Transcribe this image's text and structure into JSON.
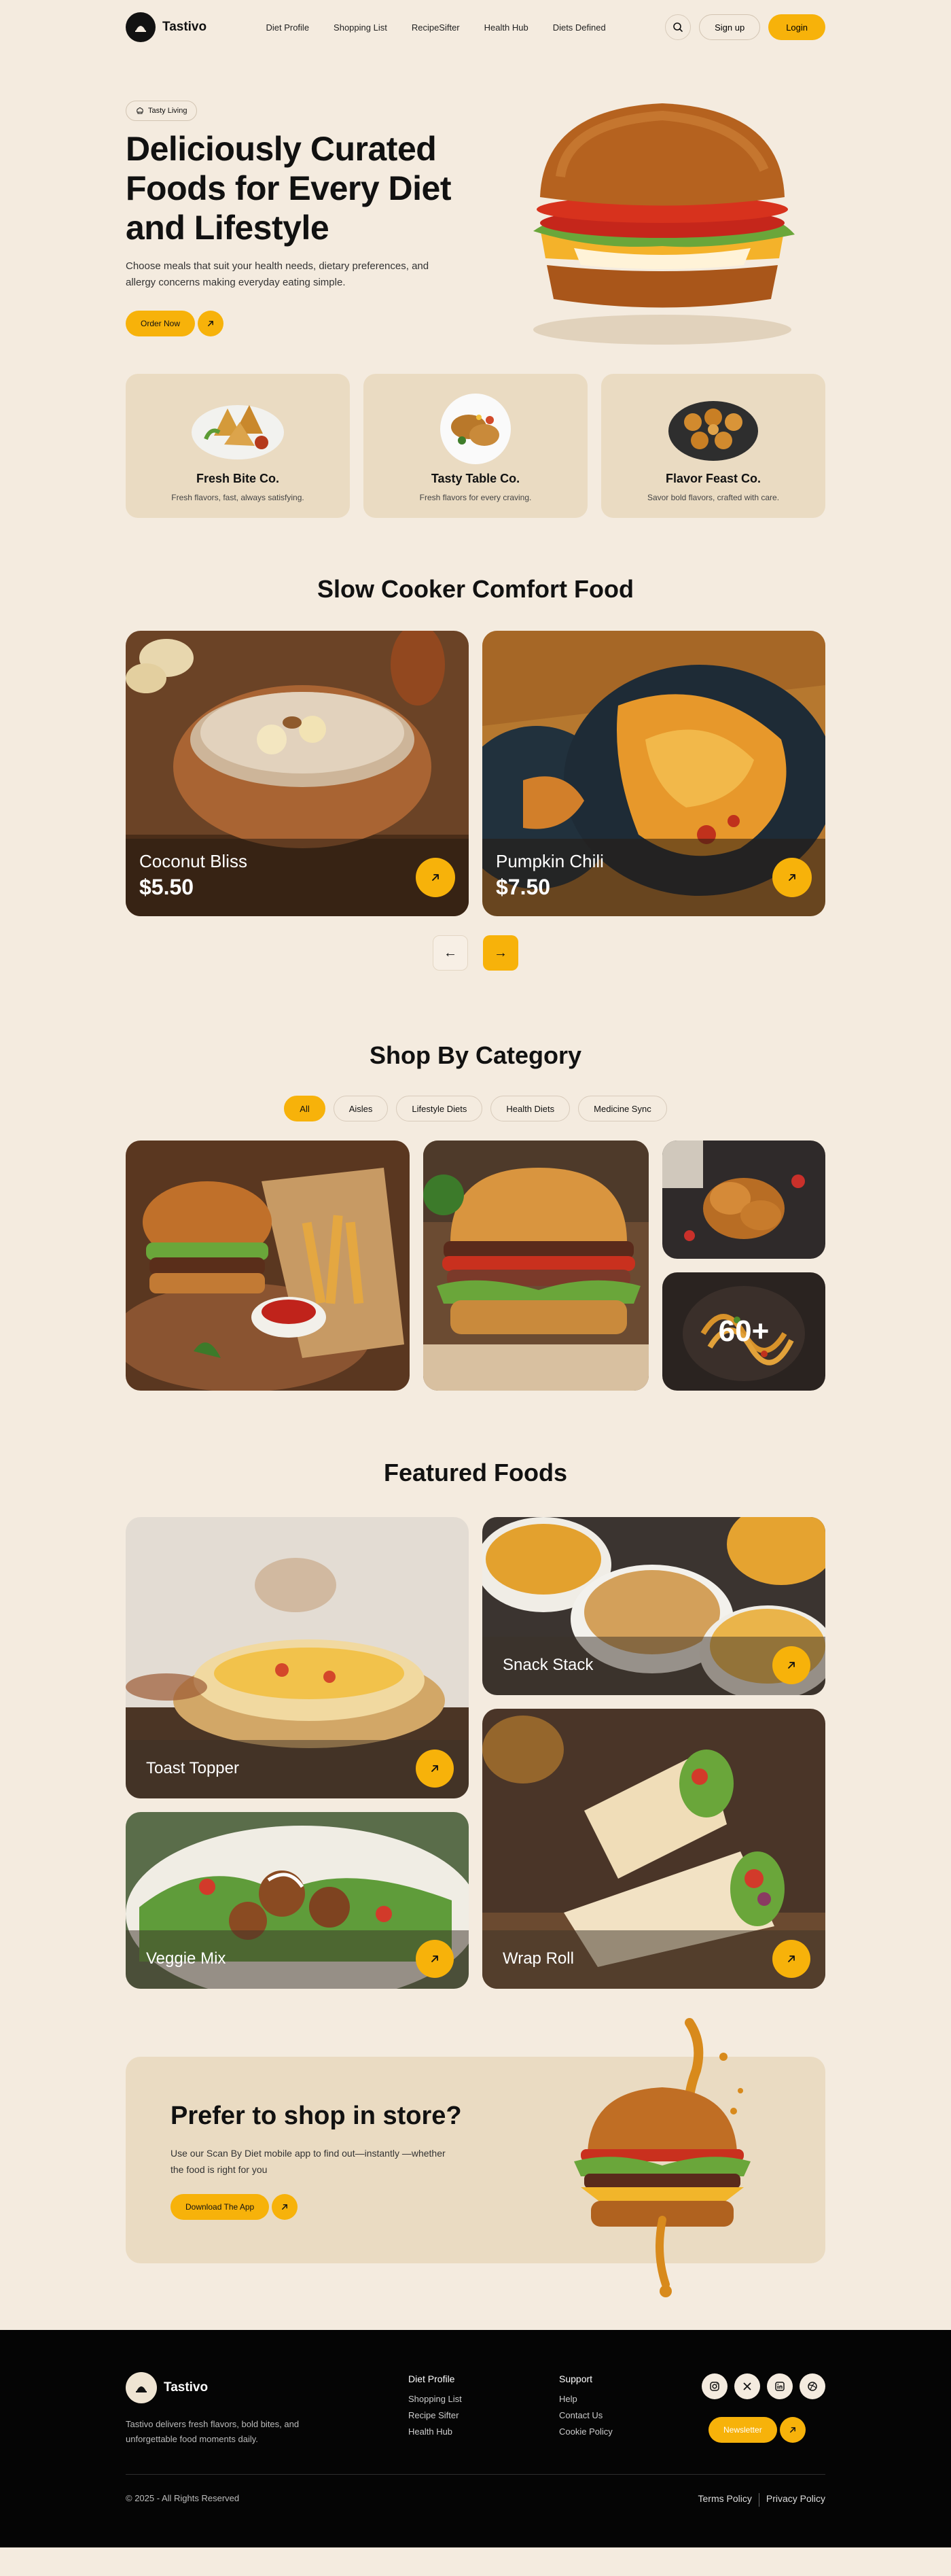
{
  "brand": {
    "name": "Tastivo"
  },
  "nav": {
    "links": [
      "Diet Profile",
      "Shopping List",
      "RecipeSifter",
      "Health Hub",
      "Diets Defined"
    ],
    "signup": "Sign up",
    "login": "Login"
  },
  "hero": {
    "tag": "Tasty Living",
    "title": "Deliciously Curated Foods for Every Diet and Lifestyle",
    "description": "Choose meals that suit your health needs, dietary preferences, and allergy concerns making everyday eating simple.",
    "cta": "Order Now"
  },
  "brand_cards": [
    {
      "title": "Fresh Bite Co.",
      "subtitle": "Fresh flavors, fast, always satisfying."
    },
    {
      "title": "Tasty Table Co.",
      "subtitle": "Fresh flavors for every craving."
    },
    {
      "title": "Flavor Feast Co.",
      "subtitle": "Savor bold flavors, crafted with care."
    }
  ],
  "slow_cooker": {
    "title": "Slow Cooker Comfort Food",
    "items": [
      {
        "name": "Coconut Bliss",
        "price": "$5.50"
      },
      {
        "name": "Pumpkin Chili",
        "price": "$7.50"
      }
    ],
    "prev_icon": "arrow-left-icon",
    "next_icon": "arrow-right-icon"
  },
  "category": {
    "title": "Shop By Category",
    "chips": [
      "All",
      "Aisles",
      "Lifestyle Diets",
      "Health Diets",
      "Medicine Sync"
    ],
    "active_chip": "All",
    "more_count": "60+"
  },
  "featured": {
    "title": "Featured Foods",
    "items": [
      "Toast Topper",
      "Snack Stack",
      "Veggie Mix",
      "Wrap Roll"
    ]
  },
  "store": {
    "title": "Prefer to shop in store?",
    "description": "Use our Scan By Diet mobile app to find out—instantly —whether the food is right for you",
    "cta": "Download The App"
  },
  "footer": {
    "brand": "Tastivo",
    "description": "Tastivo delivers fresh flavors, bold bites, and unforgettable food moments daily.",
    "col1": {
      "heading": "Diet Profile",
      "links": [
        "Shopping List",
        "Recipe Sifter",
        "Health Hub"
      ]
    },
    "col2": {
      "heading": "Support",
      "links": [
        "Help",
        "Contact Us",
        "Cookie Policy"
      ]
    },
    "socials": [
      "instagram-icon",
      "x-icon",
      "linkedin-icon",
      "dribbble-icon"
    ],
    "newsletter": "Newsletter",
    "copyright": "© 2025 - All Rights Reserved",
    "terms": "Terms Policy",
    "privacy": "Privacy Policy"
  },
  "colors": {
    "accent": "#f7b20a",
    "background": "#f4ebdf",
    "card": "#eadbc2",
    "footer": "#050505"
  }
}
